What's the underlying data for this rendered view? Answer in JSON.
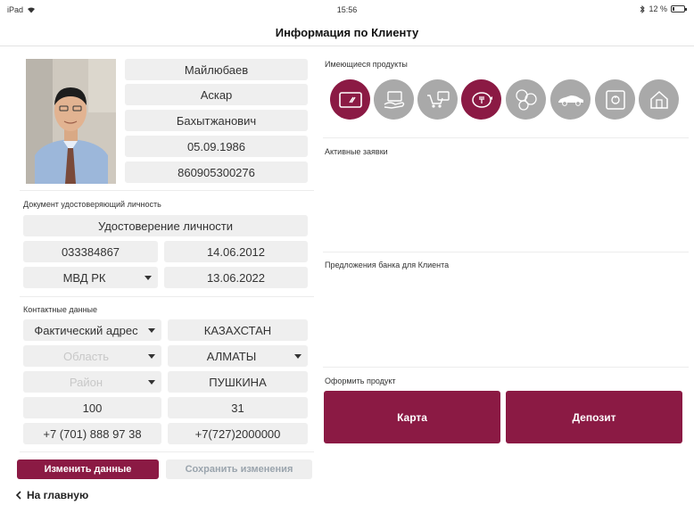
{
  "status_bar": {
    "device": "iPad",
    "time": "15:56",
    "battery": "12 %"
  },
  "header": {
    "title": "Информация по Клиенту"
  },
  "client": {
    "last_name": "Майлюбаев",
    "first_name": "Аскар",
    "patronymic": "Бахытжанович",
    "birth_date": "05.09.1986",
    "iin": "860905300276"
  },
  "document": {
    "section_label": "Документ удостоверяющий личность",
    "type": "Удостоверение личности",
    "number": "033384867",
    "issue_date": "14.06.2012",
    "issuer": "МВД РК",
    "expiry_date": "13.06.2022"
  },
  "contacts": {
    "section_label": "Контактные данные",
    "address_type": "Фактический адрес",
    "country": "КАЗАХСТАН",
    "region_placeholder": "Область",
    "city": "АЛМАТЫ",
    "district_placeholder": "Район",
    "street": "ПУШКИНА",
    "house": "100",
    "apartment": "31",
    "mobile_phone": "+7 (701) 888 97 38",
    "home_phone": "+7(727)2000000"
  },
  "actions": {
    "edit": "Изменить данные",
    "save": "Сохранить изменения"
  },
  "products": {
    "label": "Имеющиеся продукты",
    "icons": [
      {
        "name": "card-icon",
        "active": true
      },
      {
        "name": "hand-card-icon",
        "active": false
      },
      {
        "name": "cart-card-icon",
        "active": false
      },
      {
        "name": "piggy-bank-icon",
        "active": true
      },
      {
        "name": "coins-icon",
        "active": false
      },
      {
        "name": "car-icon",
        "active": false
      },
      {
        "name": "safe-icon",
        "active": false
      },
      {
        "name": "house-icon",
        "active": false
      }
    ]
  },
  "active_requests": {
    "label": "Активные заявки"
  },
  "offers": {
    "label": "Предложения банка для Клиента"
  },
  "apply": {
    "label": "Оформить продукт",
    "card": "Карта",
    "deposit": "Депозит"
  },
  "nav": {
    "back": "На главную"
  },
  "colors": {
    "accent": "#8b1a44",
    "field_bg": "#efefef",
    "icon_inactive": "#a9a9a9"
  }
}
